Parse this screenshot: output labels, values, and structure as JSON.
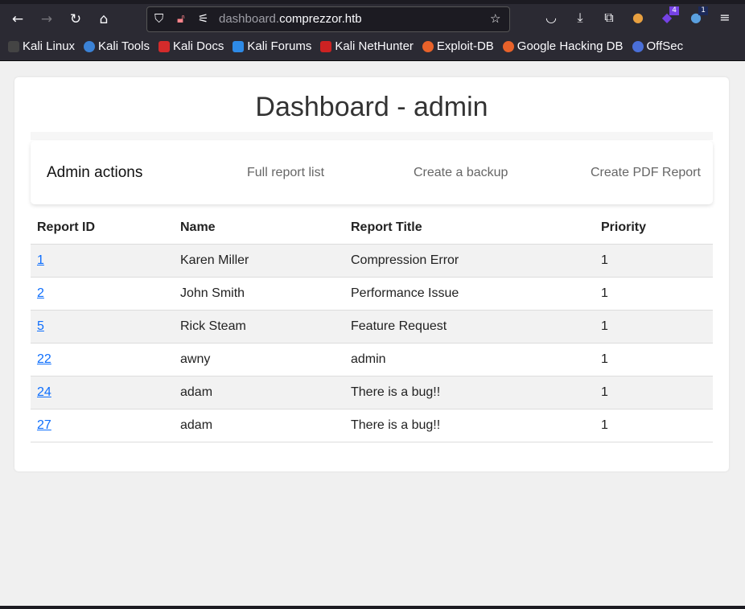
{
  "browser": {
    "url_domain_prefix": "dashboard.",
    "url_domain": "comprezzor.htb",
    "ext_badges": [
      "4",
      "1"
    ],
    "bookmarks": [
      "Kali Linux",
      "Kali Tools",
      "Kali Docs",
      "Kali Forums",
      "Kali NetHunter",
      "Exploit-DB",
      "Google Hacking DB",
      "OffSec"
    ]
  },
  "page": {
    "title": "Dashboard - admin",
    "admin": {
      "heading": "Admin actions",
      "links": [
        "Full report list",
        "Create a backup",
        "Create PDF Report"
      ]
    },
    "table": {
      "headers": [
        "Report ID",
        "Name",
        "Report Title",
        "Priority"
      ],
      "rows": [
        [
          "1",
          "Karen Miller",
          "Compression Error",
          "1"
        ],
        [
          "2",
          "John Smith",
          "Performance Issue",
          "1"
        ],
        [
          "5",
          "Rick Steam",
          "Feature Request",
          "1"
        ],
        [
          "22",
          "awny",
          "admin",
          "1"
        ],
        [
          "24",
          "adam",
          "There is a bug!!",
          "1"
        ],
        [
          "27",
          "adam",
          "There is a bug!!",
          "1"
        ]
      ]
    }
  }
}
